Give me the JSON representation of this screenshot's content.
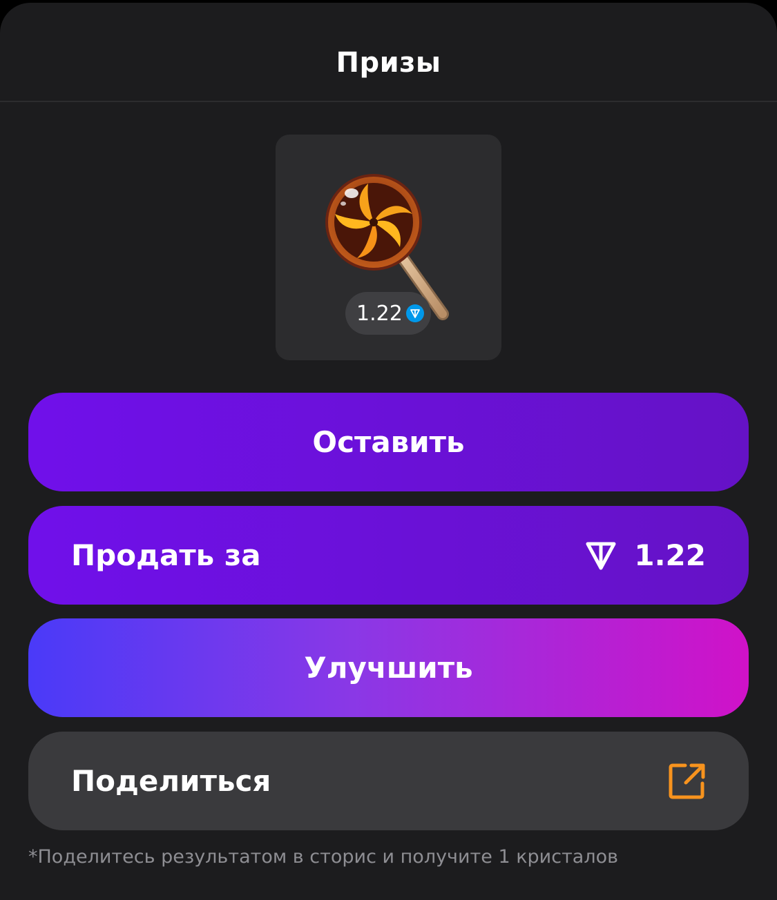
{
  "header": {
    "title": "Призы"
  },
  "prize": {
    "image": "lollipop-icon",
    "price": "1.22",
    "currency_icon": "ton-icon"
  },
  "buttons": {
    "keep_label": "Оставить",
    "sell_label": "Продать за",
    "sell_price": "1.22",
    "upgrade_label": "Улучшить",
    "share_label": "Поделиться",
    "share_icon": "external-link-icon"
  },
  "footnote": "*Поделитесь результатом в сторис и получите 1 кристалов",
  "colors": {
    "background": "#1c1c1e",
    "primary_button": "#6a10d8",
    "upgrade_gradient_start": "#4a3af8",
    "upgrade_gradient_end": "#d012c8",
    "share_button": "#3a3a3d",
    "share_icon": "#f7931e",
    "ton_blue": "#0098ea"
  }
}
